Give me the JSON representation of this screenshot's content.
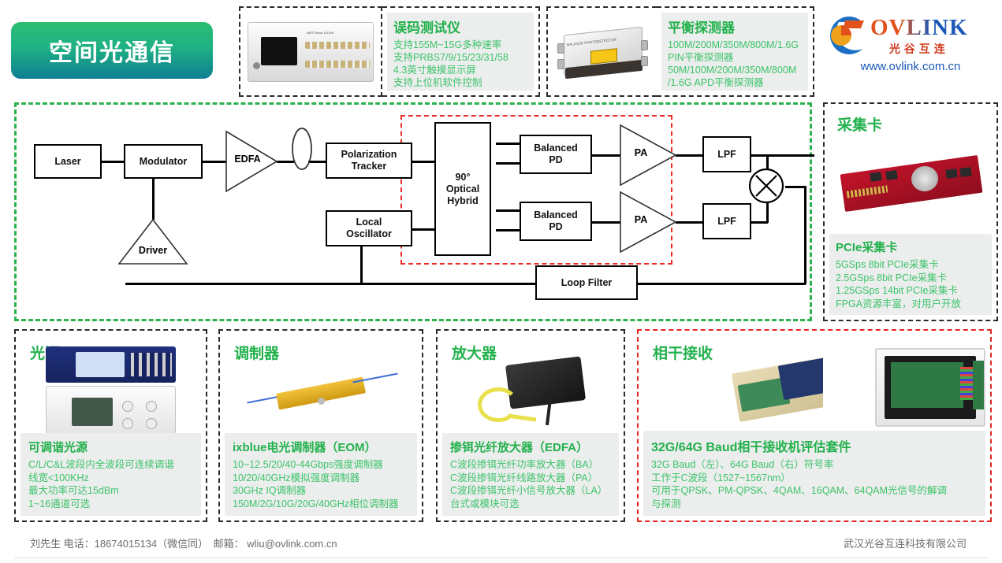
{
  "banner": {
    "title": "空间光通信"
  },
  "top_cards": [
    {
      "id": "bert",
      "title": "误码测试仪",
      "photo_name": "bert-tester-photo",
      "specs": [
        "支持155M~15G多种速率",
        "支持PRBS7/9/15/23/31/58",
        "4.3英寸触摸显示屏",
        "支持上位机软件控制"
      ]
    },
    {
      "id": "balanced-detector",
      "title": "平衡探测器",
      "photo_name": "balanced-photodetector-photo",
      "specs": [
        "100M/200M/350M/800M/1.6G",
        "PIN平衡探测器",
        "50M/100M/200M/350M/800M",
        "/1.6G APD平衡探测器"
      ]
    }
  ],
  "logo": {
    "wordmark": "OVLINK",
    "chinese": "光谷互连",
    "url": "www.ovlink.com.cn"
  },
  "diagram": {
    "blocks": {
      "laser": "Laser",
      "modulator": "Modulator",
      "driver": "Driver",
      "edfa": "EDFA",
      "polarization_tracker": "Polarization\nTracker",
      "local_oscillator": "Local\nOscillator",
      "optical_hybrid": "90°\nOptical\nHybrid",
      "balanced_pd_top": "Balanced\nPD",
      "balanced_pd_bot": "Balanced\nPD",
      "pa_top": "PA",
      "pa_bot": "PA",
      "lpf_top": "LPF",
      "lpf_bot": "LPF",
      "mixer": "X",
      "loop_filter": "Loop Filter"
    }
  },
  "pcie": {
    "header": "采集卡",
    "photo_name": "pcie-acquisition-card-photo",
    "name": "PCIe采集卡",
    "specs": [
      "5GSps 8bit PCIe采集卡",
      "2.5GSps 8bit PCIe采集卡",
      "1.25GSps 14bit PCIe采集卡",
      "FPGA资源丰富，对用户开放"
    ]
  },
  "products": [
    {
      "id": "light-source",
      "header": "光源",
      "name": "可调谐光源",
      "specs": [
        "C/L/C&L波段内全波段可连续调谐",
        "线宽<100KHz",
        "最大功率可达15dBm",
        "1~16通道可选"
      ]
    },
    {
      "id": "modulator",
      "header": "调制器",
      "name": "ixblue电光调制器（EOM）",
      "specs": [
        "10~12.5/20/40-44Gbps强度调制器",
        "10/20/40GHz模拟强度调制器",
        "30GHz IQ调制器",
        "150M/2G/10G/20G/40GHz相位调制器"
      ]
    },
    {
      "id": "amplifier",
      "header": "放大器",
      "name": "掺铒光纤放大器（EDFA）",
      "specs": [
        "C波段掺铒光纤功率放大器（BA）",
        "C波段掺铒光纤线路放大器（PA）",
        "C波段掺铒光纤小信号放大器（LA）",
        "台式或模块可选"
      ]
    },
    {
      "id": "coherent-receiver",
      "header": "相干接收",
      "name": "32G/64G Baud相干接收机评估套件",
      "specs": [
        "32G Baud（左）、64G Baud（右）符号率",
        "工作于C波段（1527~1567nm）",
        "可用于QPSK、PM-QPSK、4QAM、16QAM、64QAM光信号的解调",
        "与探测"
      ]
    }
  ],
  "footer": {
    "contact": "刘先生  电话：18674015134（微信同）　邮箱： wliu@ovlink.com.cn",
    "company": "武汉光谷互连科技有限公司"
  },
  "colors": {
    "green_head": "#22b14c",
    "green_body": "#3cc46a",
    "red_dash": "#e2281f",
    "banner_from": "#2bbd72",
    "banner_to": "#0e7f92"
  }
}
